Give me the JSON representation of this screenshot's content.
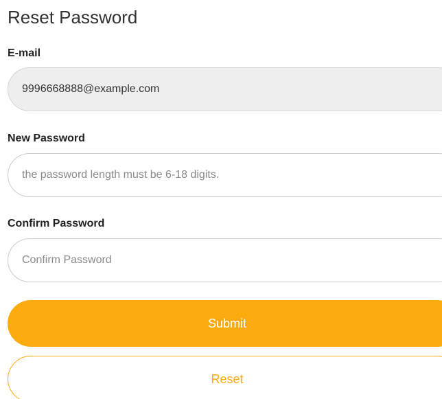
{
  "form": {
    "title": "Reset Password",
    "email": {
      "label": "E-mail",
      "value": "9996668888@example.com"
    },
    "new_password": {
      "label": "New Password",
      "placeholder": "the password length must be 6-18 digits."
    },
    "confirm_password": {
      "label": "Confirm Password",
      "placeholder": "Confirm Password"
    },
    "submit_label": "Submit",
    "reset_label": "Reset"
  },
  "colors": {
    "accent": "#fcab0f",
    "readonly_bg": "#eeeeee",
    "border": "#cccccc"
  }
}
